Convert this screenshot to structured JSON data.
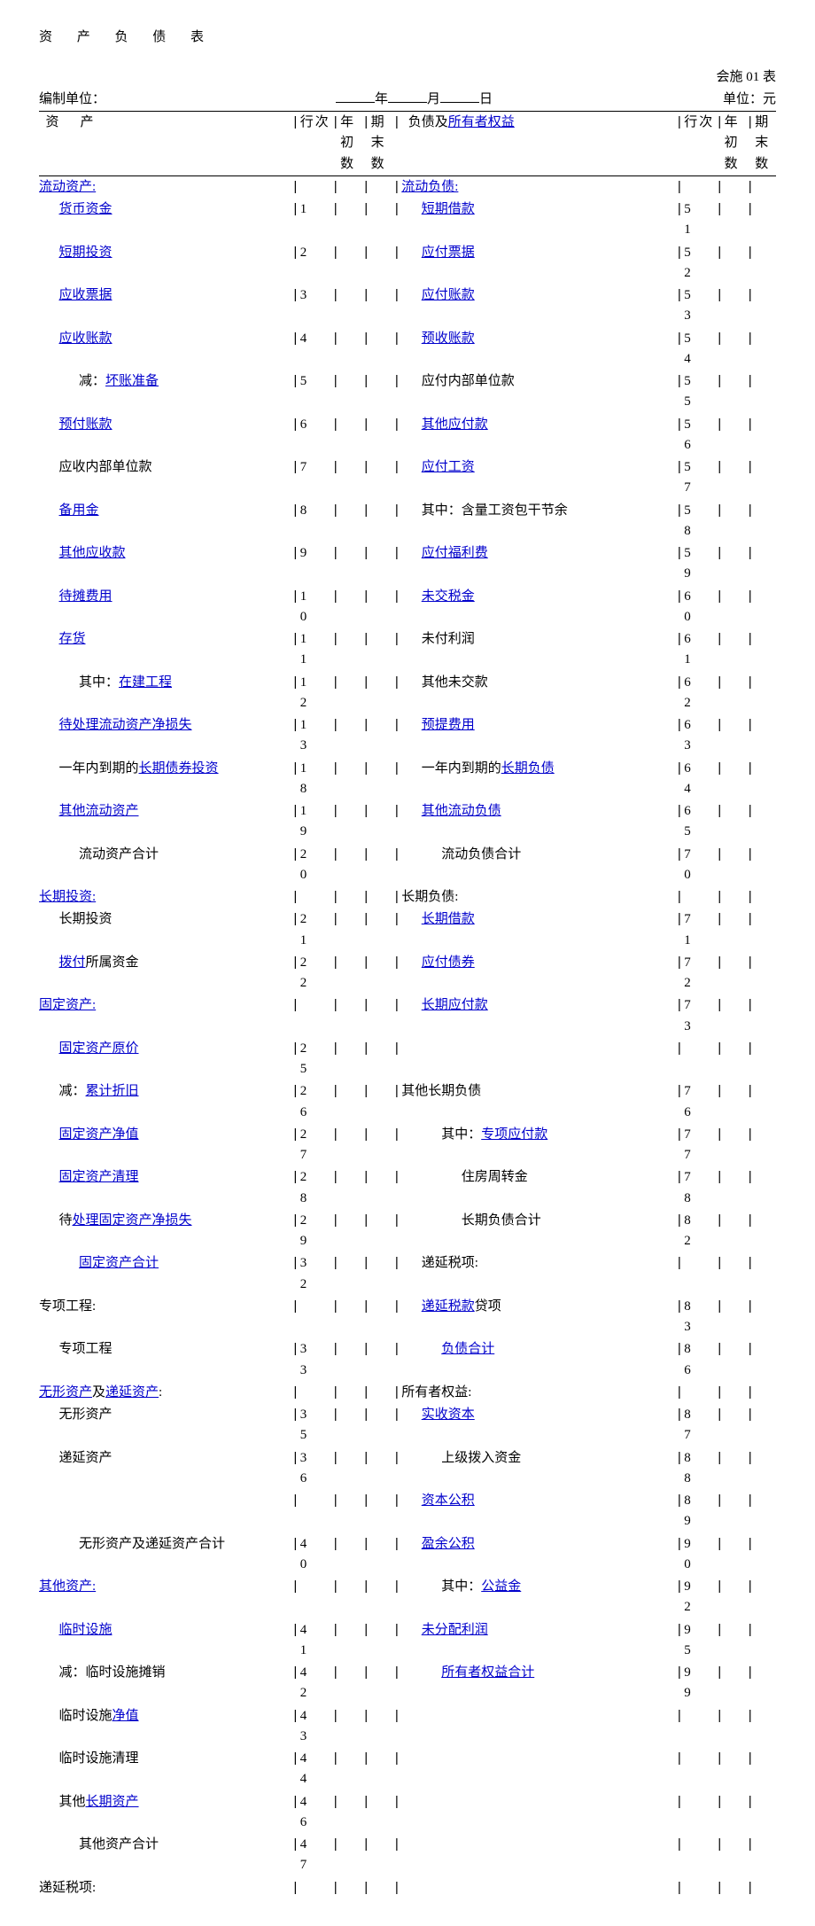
{
  "page": {
    "title": "资 产 负 债 表",
    "form_no": "会施 01 表",
    "unit_label": "编制单位：",
    "date_year": "年",
    "date_month": "月",
    "date_day": "日",
    "currency_unit": "单位：元"
  },
  "hdr": {
    "asset": "资",
    "asset2": "产",
    "row": "行次",
    "begin": "年初数",
    "end": "期末数",
    "liab": "负债及",
    "owner_equity": "所有者权益",
    "row2": "行次",
    "begin2": "年初数",
    "end2": "期末数"
  },
  "rows": [
    {
      "a": {
        "seg": [
          {
            "t": "流动资产:",
            "l": 1
          }
        ],
        "ind": 0
      },
      "ar": "",
      "b": {
        "seg": [
          {
            "t": "流动负债:",
            "l": 1
          }
        ],
        "ind": 0
      },
      "br": ""
    },
    {
      "a": {
        "seg": [
          {
            "t": "货币资金",
            "l": 1
          }
        ],
        "ind": 1
      },
      "ar": "1",
      "b": {
        "seg": [
          {
            "t": "短期借款",
            "l": 1
          }
        ],
        "ind": 1
      },
      "br": "5 1"
    },
    {
      "a": {
        "seg": [
          {
            "t": "短期投资",
            "l": 1
          }
        ],
        "ind": 1
      },
      "ar": "2",
      "b": {
        "seg": [
          {
            "t": "应付票据",
            "l": 1
          }
        ],
        "ind": 1
      },
      "br": "5 2"
    },
    {
      "a": {
        "seg": [
          {
            "t": "应收票据",
            "l": 1
          }
        ],
        "ind": 1
      },
      "ar": "3",
      "b": {
        "seg": [
          {
            "t": "应付账款",
            "l": 1
          }
        ],
        "ind": 1
      },
      "br": "5 3"
    },
    {
      "a": {
        "seg": [
          {
            "t": "应收账款",
            "l": 1
          }
        ],
        "ind": 1
      },
      "ar": "4",
      "b": {
        "seg": [
          {
            "t": "预收账款",
            "l": 1
          }
        ],
        "ind": 1
      },
      "br": "5 4"
    },
    {
      "a": {
        "seg": [
          {
            "t": "减："
          },
          {
            "t": "坏账准备",
            "l": 1
          }
        ],
        "ind": 2
      },
      "ar": "5",
      "b": {
        "seg": [
          {
            "t": "应付内部单位款"
          }
        ],
        "ind": 1
      },
      "br": "5 5"
    },
    {
      "a": {
        "seg": [
          {
            "t": "预付账款",
            "l": 1
          }
        ],
        "ind": 1
      },
      "ar": "6",
      "b": {
        "seg": [
          {
            "t": "其他应付款",
            "l": 1
          }
        ],
        "ind": 1
      },
      "br": "5 6"
    },
    {
      "a": {
        "seg": [
          {
            "t": "应收内部单位款"
          }
        ],
        "ind": 1
      },
      "ar": "7",
      "b": {
        "seg": [
          {
            "t": "应付工资",
            "l": 1
          }
        ],
        "ind": 1
      },
      "br": "5 7"
    },
    {
      "a": {
        "seg": [
          {
            "t": "备用金",
            "l": 1
          }
        ],
        "ind": 1
      },
      "ar": "8",
      "b": {
        "seg": [
          {
            "t": "其中：含量工资包干节余"
          }
        ],
        "ind": 1
      },
      "br": "5 8"
    },
    {
      "a": {
        "seg": [
          {
            "t": "其他应收款",
            "l": 1
          }
        ],
        "ind": 1
      },
      "ar": "9",
      "b": {
        "seg": [
          {
            "t": "应付福利费",
            "l": 1
          }
        ],
        "ind": 1
      },
      "br": "5 9"
    },
    {
      "a": {
        "seg": [
          {
            "t": "待摊费用",
            "l": 1
          }
        ],
        "ind": 1
      },
      "ar": "1 0",
      "b": {
        "seg": [
          {
            "t": "未交税金",
            "l": 1
          }
        ],
        "ind": 1
      },
      "br": "6 0"
    },
    {
      "a": {
        "seg": [
          {
            "t": "存货",
            "l": 1
          }
        ],
        "ind": 1
      },
      "ar": "1 1",
      "b": {
        "seg": [
          {
            "t": "未付利润"
          }
        ],
        "ind": 1
      },
      "br": "6 1"
    },
    {
      "a": {
        "seg": [
          {
            "t": "其中："
          },
          {
            "t": "在建工程",
            "l": 1
          }
        ],
        "ind": 2
      },
      "ar": "1 2",
      "b": {
        "seg": [
          {
            "t": "其他未交款"
          }
        ],
        "ind": 1
      },
      "br": "6 2"
    },
    {
      "a": {
        "seg": [
          {
            "t": "待处理流动资产净损失",
            "l": 1
          }
        ],
        "ind": 1
      },
      "ar": "1 3",
      "b": {
        "seg": [
          {
            "t": "预提费用",
            "l": 1
          }
        ],
        "ind": 1
      },
      "br": "6 3"
    },
    {
      "a": {
        "seg": [
          {
            "t": "一年内到期的"
          },
          {
            "t": "长期债券投资",
            "l": 1
          }
        ],
        "ind": 1
      },
      "ar": "1 8",
      "b": {
        "seg": [
          {
            "t": "一年内到期的"
          },
          {
            "t": "长期负债",
            "l": 1
          }
        ],
        "ind": 1
      },
      "br": "6 4"
    },
    {
      "a": {
        "seg": [
          {
            "t": "其他流动资产",
            "l": 1
          }
        ],
        "ind": 1
      },
      "ar": "1 9",
      "b": {
        "seg": [
          {
            "t": "其他流动负债",
            "l": 1
          }
        ],
        "ind": 1
      },
      "br": "6 5"
    },
    {
      "a": {
        "seg": [
          {
            "t": "流动资产合计"
          }
        ],
        "ind": 2
      },
      "ar": "2 0",
      "b": {
        "seg": [
          {
            "t": "流动负债合计"
          }
        ],
        "ind": 2
      },
      "br": "7 0"
    },
    {
      "a": {
        "seg": [
          {
            "t": "长期投资:",
            "l": 1
          }
        ],
        "ind": 0
      },
      "ar": "",
      "b": {
        "seg": [
          {
            "t": "长期负债:"
          }
        ],
        "ind": 0
      },
      "br": ""
    },
    {
      "a": {
        "seg": [
          {
            "t": "长期投资"
          }
        ],
        "ind": 1
      },
      "ar": "2 1",
      "b": {
        "seg": [
          {
            "t": "长期借款",
            "l": 1
          }
        ],
        "ind": 1
      },
      "br": "7 1"
    },
    {
      "a": {
        "seg": [
          {
            "t": "拨付",
            "l": 1
          },
          {
            "t": "所属资金"
          }
        ],
        "ind": 1
      },
      "ar": "2 2",
      "b": {
        "seg": [
          {
            "t": "应付债券",
            "l": 1
          }
        ],
        "ind": 1
      },
      "br": "7 2"
    },
    {
      "a": {
        "seg": [
          {
            "t": "固定资产:",
            "l": 1
          }
        ],
        "ind": 0
      },
      "ar": "",
      "b": {
        "seg": [
          {
            "t": "长期应付款",
            "l": 1
          }
        ],
        "ind": 1
      },
      "br": "7 3"
    },
    {
      "a": {
        "seg": [
          {
            "t": "固定资产原价",
            "l": 1
          }
        ],
        "ind": 1
      },
      "ar": "2 5",
      "b": {
        "seg": [],
        "ind": 0
      },
      "br": ""
    },
    {
      "a": {
        "seg": [
          {
            "t": "减："
          },
          {
            "t": "累计折旧",
            "l": 1
          }
        ],
        "ind": 1
      },
      "ar": "2 6",
      "b": {
        "seg": [
          {
            "t": "其他长期负债"
          }
        ],
        "ind": 0
      },
      "br": "7 6"
    },
    {
      "a": {
        "seg": [
          {
            "t": "固定资产净值",
            "l": 1
          }
        ],
        "ind": 1
      },
      "ar": "2 7",
      "b": {
        "seg": [
          {
            "t": "其中："
          },
          {
            "t": "专项应付款",
            "l": 1
          }
        ],
        "ind": 2
      },
      "br": "7 7"
    },
    {
      "a": {
        "seg": [
          {
            "t": "固定资产清理",
            "l": 1
          }
        ],
        "ind": 1
      },
      "ar": "2 8",
      "b": {
        "seg": [
          {
            "t": "住房周转金"
          }
        ],
        "ind": 3
      },
      "br": "7 8"
    },
    {
      "a": {
        "seg": [
          {
            "t": "待"
          },
          {
            "t": "处理固定资产净损失",
            "l": 1
          }
        ],
        "ind": 1
      },
      "ar": "2 9",
      "b": {
        "seg": [
          {
            "t": "长期负债合计"
          }
        ],
        "ind": 3
      },
      "br": "8 2"
    },
    {
      "a": {
        "seg": [
          {
            "t": "固定资产合计",
            "l": 1
          }
        ],
        "ind": 2
      },
      "ar": "3 2",
      "b": {
        "seg": [
          {
            "t": "递延税项:"
          }
        ],
        "ind": 1
      },
      "br": ""
    },
    {
      "a": {
        "seg": [
          {
            "t": "专项工程:"
          }
        ],
        "ind": 0
      },
      "ar": "",
      "b": {
        "seg": [
          {
            "t": "递延税款",
            "l": 1
          },
          {
            "t": "贷项"
          }
        ],
        "ind": 1
      },
      "br": "8 3"
    },
    {
      "a": {
        "seg": [
          {
            "t": "专项工程"
          }
        ],
        "ind": 1
      },
      "ar": "3 3",
      "b": {
        "seg": [
          {
            "t": "负债合计",
            "l": 1
          }
        ],
        "ind": 2
      },
      "br": "8 6"
    },
    {
      "a": {
        "seg": [
          {
            "t": "无形资产",
            "l": 1
          },
          {
            "t": "及"
          },
          {
            "t": "递延资产",
            "l": 1
          },
          {
            "t": ":"
          }
        ],
        "ind": 0
      },
      "ar": "",
      "b": {
        "seg": [
          {
            "t": "所有者权益:"
          }
        ],
        "ind": 0
      },
      "br": ""
    },
    {
      "a": {
        "seg": [
          {
            "t": "无形资产"
          }
        ],
        "ind": 1
      },
      "ar": "3 5",
      "b": {
        "seg": [
          {
            "t": "实收资本",
            "l": 1
          }
        ],
        "ind": 1
      },
      "br": "8 7"
    },
    {
      "a": {
        "seg": [
          {
            "t": "递延资产"
          }
        ],
        "ind": 1
      },
      "ar": "3 6",
      "b": {
        "seg": [
          {
            "t": "上级拨入资金"
          }
        ],
        "ind": 2
      },
      "br": "8 8"
    },
    {
      "a": {
        "seg": [],
        "ind": 0
      },
      "ar": "",
      "b": {
        "seg": [
          {
            "t": "资本公积",
            "l": 1
          }
        ],
        "ind": 1
      },
      "br": "8 9"
    },
    {
      "a": {
        "seg": [
          {
            "t": "无形资产及递延资产合计"
          }
        ],
        "ind": 2
      },
      "ar": "4 0",
      "b": {
        "seg": [
          {
            "t": "盈余公积",
            "l": 1
          }
        ],
        "ind": 1
      },
      "br": "9 0"
    },
    {
      "a": {
        "seg": [
          {
            "t": "其他资产:",
            "l": 1
          }
        ],
        "ind": 0
      },
      "ar": "",
      "b": {
        "seg": [
          {
            "t": "其中："
          },
          {
            "t": "公益金",
            "l": 1
          }
        ],
        "ind": 2
      },
      "br": "9 2"
    },
    {
      "a": {
        "seg": [
          {
            "t": "临时设施",
            "l": 1
          }
        ],
        "ind": 1
      },
      "ar": "4 1",
      "b": {
        "seg": [
          {
            "t": "未分配利润",
            "l": 1
          }
        ],
        "ind": 1
      },
      "br": "9 5"
    },
    {
      "a": {
        "seg": [
          {
            "t": "减：临时设施摊销"
          }
        ],
        "ind": 1
      },
      "ar": "4 2",
      "b": {
        "seg": [
          {
            "t": "所有者权益合计",
            "l": 1
          }
        ],
        "ind": 2
      },
      "br": "9 9"
    },
    {
      "a": {
        "seg": [
          {
            "t": "临时设施"
          },
          {
            "t": "净值",
            "l": 1
          }
        ],
        "ind": 1
      },
      "ar": "4 3",
      "b": {
        "seg": [],
        "ind": 0
      },
      "br": ""
    },
    {
      "a": {
        "seg": [
          {
            "t": "临时设施清理"
          }
        ],
        "ind": 1
      },
      "ar": "4 4",
      "b": {
        "seg": [],
        "ind": 0
      },
      "br": ""
    },
    {
      "a": {
        "seg": [
          {
            "t": "其他"
          },
          {
            "t": "长期资产",
            "l": 1
          }
        ],
        "ind": 1
      },
      "ar": "4 6",
      "b": {
        "seg": [],
        "ind": 0
      },
      "br": ""
    },
    {
      "a": {
        "seg": [
          {
            "t": "其他资产合计"
          }
        ],
        "ind": 2
      },
      "ar": "4 7",
      "b": {
        "seg": [],
        "ind": 0
      },
      "br": ""
    },
    {
      "a": {
        "seg": [
          {
            "t": "递延税项:"
          }
        ],
        "ind": 0
      },
      "ar": "",
      "b": {
        "seg": [],
        "ind": 0
      },
      "br": ""
    }
  ]
}
